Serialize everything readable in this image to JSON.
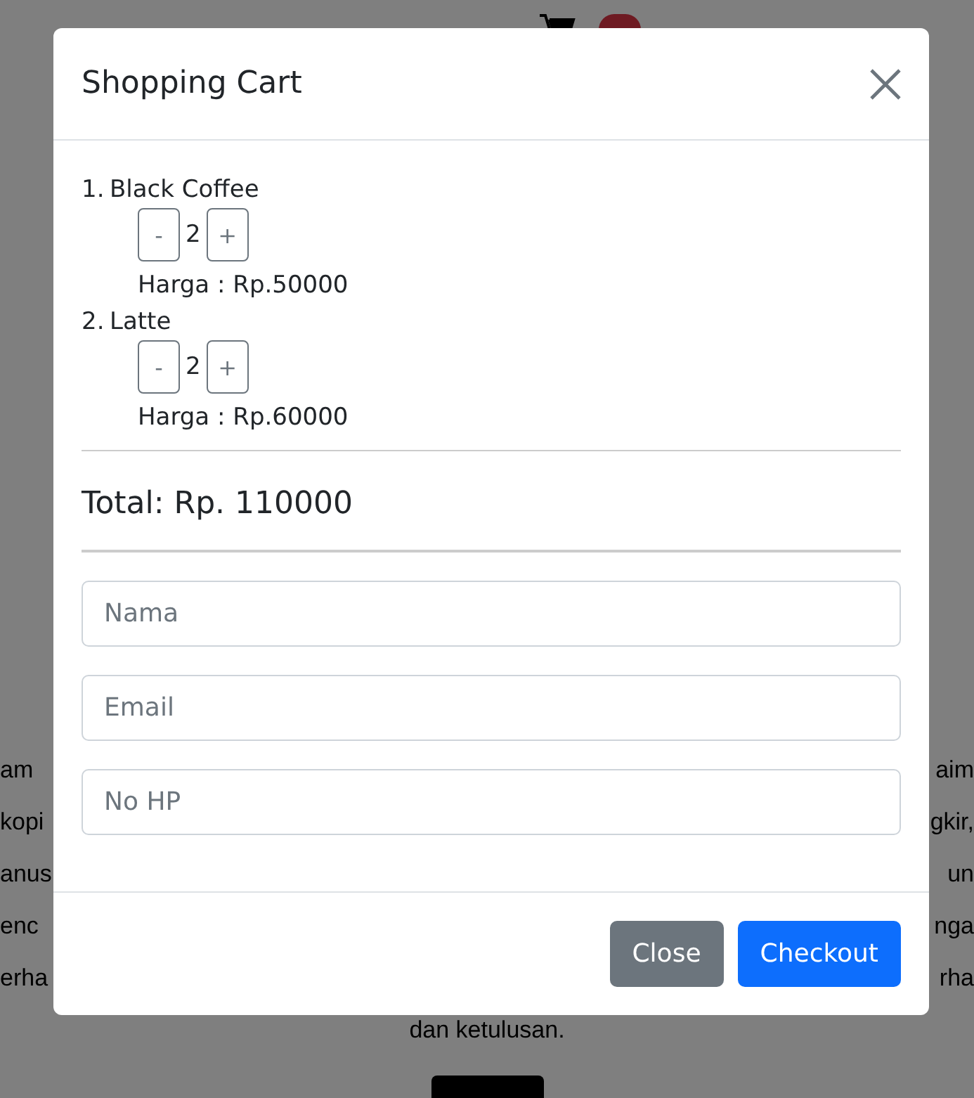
{
  "background": {
    "paragraph_lines": [
      {
        "left": "am",
        "right": "aim"
      },
      {
        "left": "kopi",
        "right": "gkir,"
      },
      {
        "left": "anus",
        "right": "un"
      },
      {
        "left": "enc",
        "right": "nga"
      },
      {
        "left": "erha",
        "right": "rha"
      }
    ],
    "closing_line": "dan ketulusan."
  },
  "modal": {
    "title": "Shopping Cart",
    "items": [
      {
        "number": "1.",
        "name": "Black Coffee",
        "decrement": "-",
        "quantity": "2",
        "increment": "+",
        "price": "Harga : Rp.50000"
      },
      {
        "number": "2.",
        "name": "Latte",
        "decrement": "-",
        "quantity": "2",
        "increment": "+",
        "price": "Harga : Rp.60000"
      }
    ],
    "total": "Total: Rp. 110000",
    "fields": [
      {
        "placeholder": "Nama"
      },
      {
        "placeholder": "Email"
      },
      {
        "placeholder": "No HP"
      }
    ],
    "buttons": [
      {
        "label": "Close",
        "kind": "secondary"
      },
      {
        "label": "Checkout",
        "kind": "primary"
      }
    ]
  }
}
